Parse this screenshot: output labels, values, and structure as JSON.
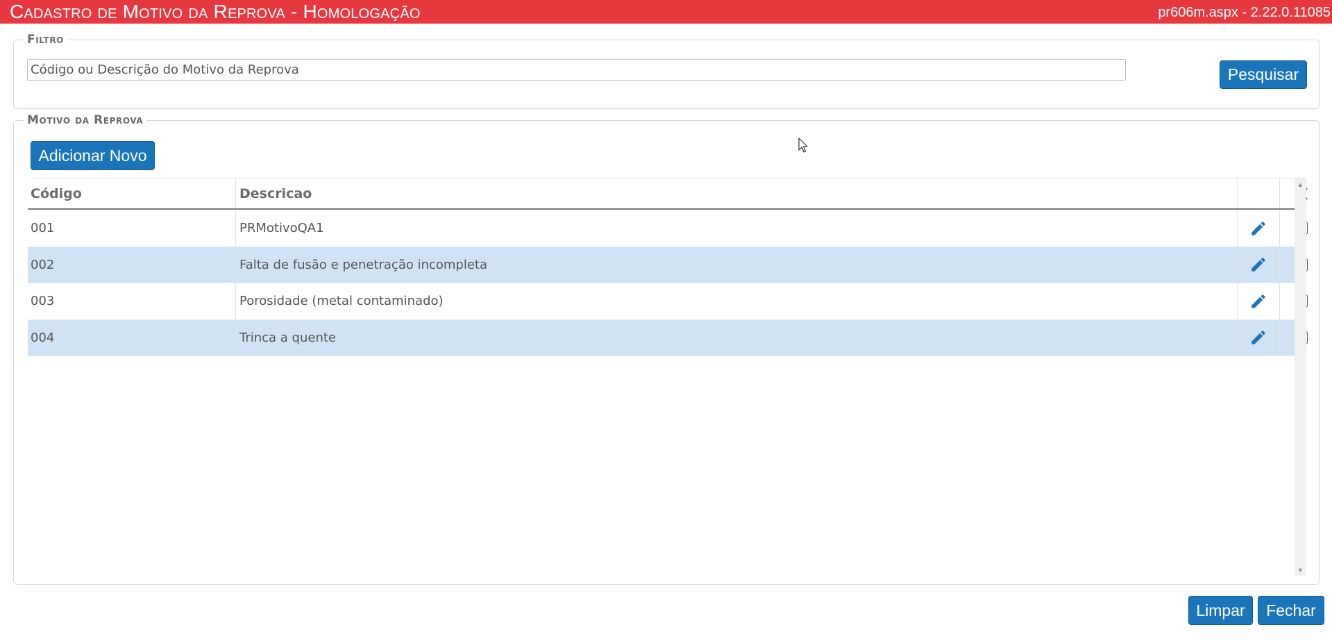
{
  "window": {
    "title": "Cadastro de Motivo da Reprova  - Homologação",
    "version": "pr606m.aspx - 2.22.0.11085"
  },
  "filtro": {
    "legend": "Filtro",
    "search_placeholder": "Código ou Descrição do Motivo da Reprova",
    "search_value": "",
    "search_button": "Pesquisar"
  },
  "motivo": {
    "legend": "Motivo da Reprova",
    "add_button": "Adicionar Novo",
    "columns": {
      "codigo": "Código",
      "descricao": "Descricao"
    },
    "header_delete_icon": "close-icon",
    "row_edit_icon": "pencil-icon",
    "rows": [
      {
        "codigo": "001",
        "descricao": "PRMotivoQA1",
        "checked": false
      },
      {
        "codigo": "002",
        "descricao": "Falta de fusão e penetração incompleta",
        "checked": false
      },
      {
        "codigo": "003",
        "descricao": "Porosidade (metal contaminado)",
        "checked": false
      },
      {
        "codigo": "004",
        "descricao": "Trinca a quente",
        "checked": false
      }
    ]
  },
  "footer": {
    "clear_button": "Limpar",
    "close_button": "Fechar"
  },
  "colors": {
    "titlebar": "#e8383f",
    "button": "#1b75bb",
    "row_alt": "#cfe3f4",
    "delete_icon": "#e0262d",
    "edit_icon": "#1b75bb"
  }
}
